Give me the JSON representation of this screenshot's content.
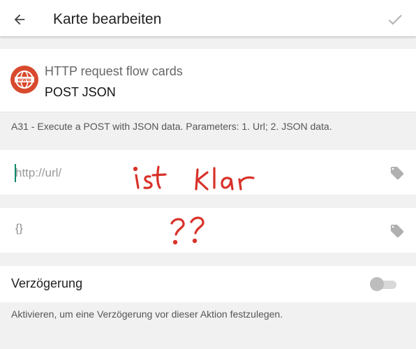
{
  "appbar": {
    "title": "Karte bearbeiten",
    "back_icon": "arrow-left-icon",
    "confirm_icon": "check-icon"
  },
  "card": {
    "app_name": "HTTP request flow cards",
    "card_name": "POST JSON",
    "icon": "www-globe-icon",
    "icon_color": "#d84a2e",
    "description": "A31 - Execute a POST with JSON data. Parameters: 1. Url; 2. JSON data."
  },
  "fields": [
    {
      "placeholder": "http://url/",
      "value": "",
      "tag_icon": "tag-icon",
      "annotation": "ist klar"
    },
    {
      "value": "{}",
      "tag_icon": "tag-icon",
      "annotation": "??"
    }
  ],
  "delay": {
    "label": "Verzögerung",
    "enabled": false,
    "hint": "Aktivieren, um eine Verzögerung vor dieser Aktion festzulegen."
  },
  "colors": {
    "annotation_red": "#d8322a",
    "cursor_teal": "#0e8a6a"
  }
}
